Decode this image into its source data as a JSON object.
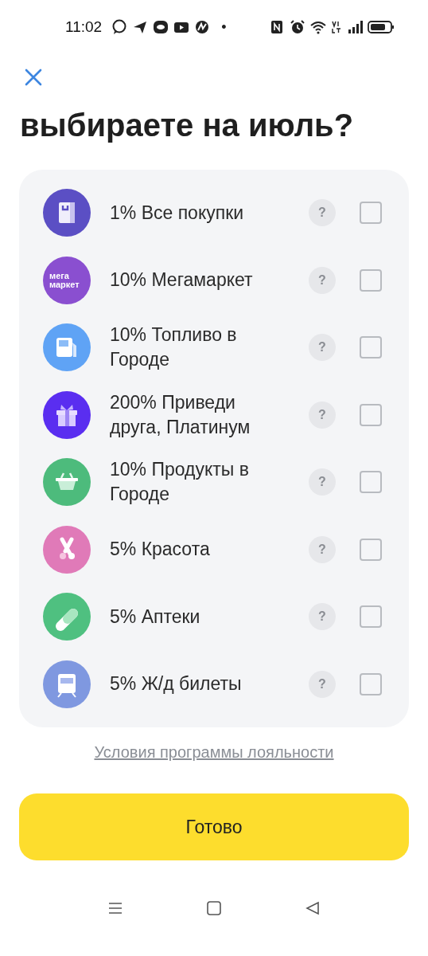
{
  "status_bar": {
    "time": "11:02",
    "dot": "•"
  },
  "title": "выбираете на июль?",
  "items": [
    {
      "kind": "bag",
      "color": "#5b4fc4",
      "label": "1% Все покупки",
      "help": "?",
      "checked": false
    },
    {
      "kind": "logo",
      "logo_text": "мега маркет",
      "color": "#8a4fd0",
      "label": "10% Мегамаркет",
      "help": "?",
      "checked": false
    },
    {
      "kind": "fuel",
      "color": "#5fa3f5",
      "label": "10% Топливо в Городе",
      "help": "?",
      "checked": false
    },
    {
      "kind": "gift",
      "color": "#5a2ef0",
      "label": "200% Приведи друга, Платинум",
      "help": "?",
      "checked": false
    },
    {
      "kind": "basket",
      "color": "#4dbb7c",
      "label": "10% Продукты в Городе",
      "help": "?",
      "checked": false
    },
    {
      "kind": "scissors",
      "color": "#e07ab8",
      "label": "5% Красота",
      "help": "?",
      "checked": false
    },
    {
      "kind": "pill",
      "color": "#4fc080",
      "label": "5% Аптеки",
      "help": "?",
      "checked": false
    },
    {
      "kind": "train",
      "color": "#7f98e0",
      "label": "5% Ж/д билеты",
      "help": "?",
      "checked": false
    }
  ],
  "terms_link": "Условия программы лояльности",
  "done_button": "Готово"
}
